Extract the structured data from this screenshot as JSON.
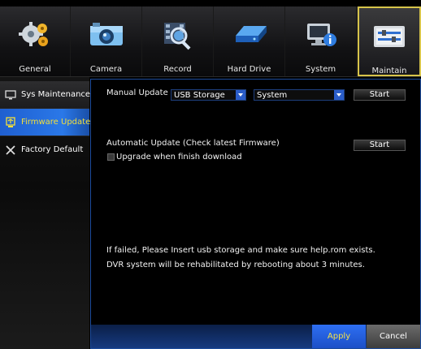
{
  "tabs": [
    {
      "label": "General",
      "icon": "gears-icon",
      "active": false
    },
    {
      "label": "Camera",
      "icon": "camera-icon",
      "active": false
    },
    {
      "label": "Record",
      "icon": "record-icon",
      "active": false
    },
    {
      "label": "Hard Drive",
      "icon": "hard-drive-icon",
      "active": false
    },
    {
      "label": "System",
      "icon": "system-info-icon",
      "active": false
    },
    {
      "label": "Maintain",
      "icon": "maintain-icon",
      "active": true
    }
  ],
  "sidebar": {
    "items": [
      {
        "label": "Sys Maintenance",
        "icon": "monitor-icon"
      },
      {
        "label": "Firmware Update",
        "icon": "firmware-icon",
        "active": true
      },
      {
        "label": "Factory Default",
        "icon": "tools-icon"
      }
    ]
  },
  "main": {
    "manual_update_label": "Manual Update",
    "storage_select": {
      "value": "USB Storage"
    },
    "type_select": {
      "value": "System"
    },
    "manual_start_label": "Start",
    "auto_update_label": "Automatic Update (Check latest Firmware)",
    "auto_start_label": "Start",
    "upgrade_checkbox_label": "Upgrade when finish download",
    "upgrade_checked": false,
    "info_line_1": "If failed, Please Insert usb storage and make sure help.rom exists.",
    "info_line_2": "DVR system will be rehabilitated by rebooting about 3 minutes."
  },
  "footer": {
    "apply_label": "Apply",
    "cancel_label": "Cancel"
  },
  "colors": {
    "accent_blue": "#2a78e8",
    "active_text_yellow": "#f3df3a",
    "active_tab_border": "#d7c44a"
  }
}
